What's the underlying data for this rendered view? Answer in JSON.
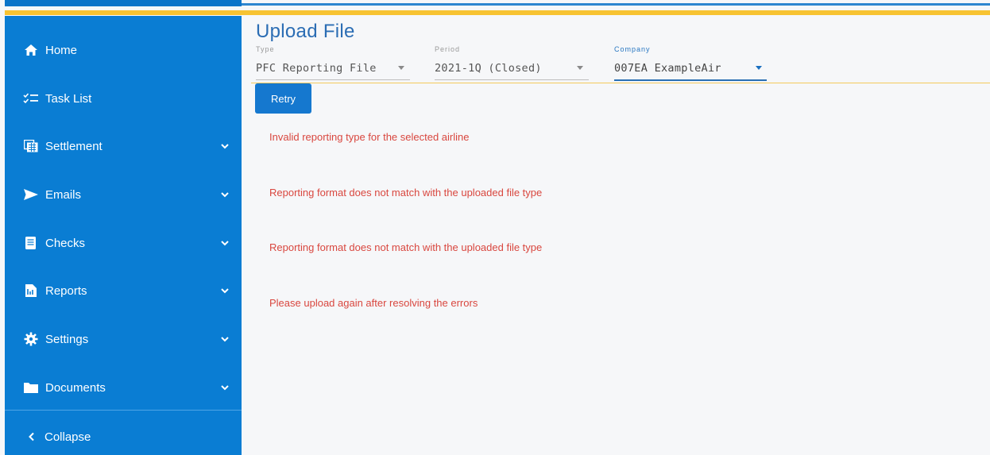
{
  "sidebar": {
    "items": [
      {
        "label": "Home",
        "icon": "home-icon",
        "expandable": false
      },
      {
        "label": "Task List",
        "icon": "task-list-icon",
        "expandable": false
      },
      {
        "label": "Settlement",
        "icon": "settlement-icon",
        "expandable": true
      },
      {
        "label": "Emails",
        "icon": "send-icon",
        "expandable": true
      },
      {
        "label": "Checks",
        "icon": "checks-icon",
        "expandable": true
      },
      {
        "label": "Reports",
        "icon": "reports-icon",
        "expandable": true
      },
      {
        "label": "Settings",
        "icon": "gear-icon",
        "expandable": true
      },
      {
        "label": "Documents",
        "icon": "folder-icon",
        "expandable": true
      }
    ],
    "collapse_label": "Collapse"
  },
  "main": {
    "title": "Upload File",
    "fields": {
      "type": {
        "label": "Type",
        "value": "PFC Reporting File"
      },
      "period": {
        "label": "Period",
        "value": "2021-1Q (Closed)"
      },
      "company": {
        "label": "Company",
        "value": "007EA ExampleAir"
      }
    },
    "retry_label": "Retry",
    "errors": [
      "Invalid reporting type for the selected airline",
      "Reporting format does not match with the uploaded file type",
      "Reporting format does not match with the uploaded file type",
      "Please upload again after resolving the errors"
    ]
  },
  "colors": {
    "sidebar": "#0a7dd3",
    "accent_yellow": "#f7c332",
    "title": "#2b6db4",
    "error": "#d9473f",
    "button": "#1578cf"
  }
}
